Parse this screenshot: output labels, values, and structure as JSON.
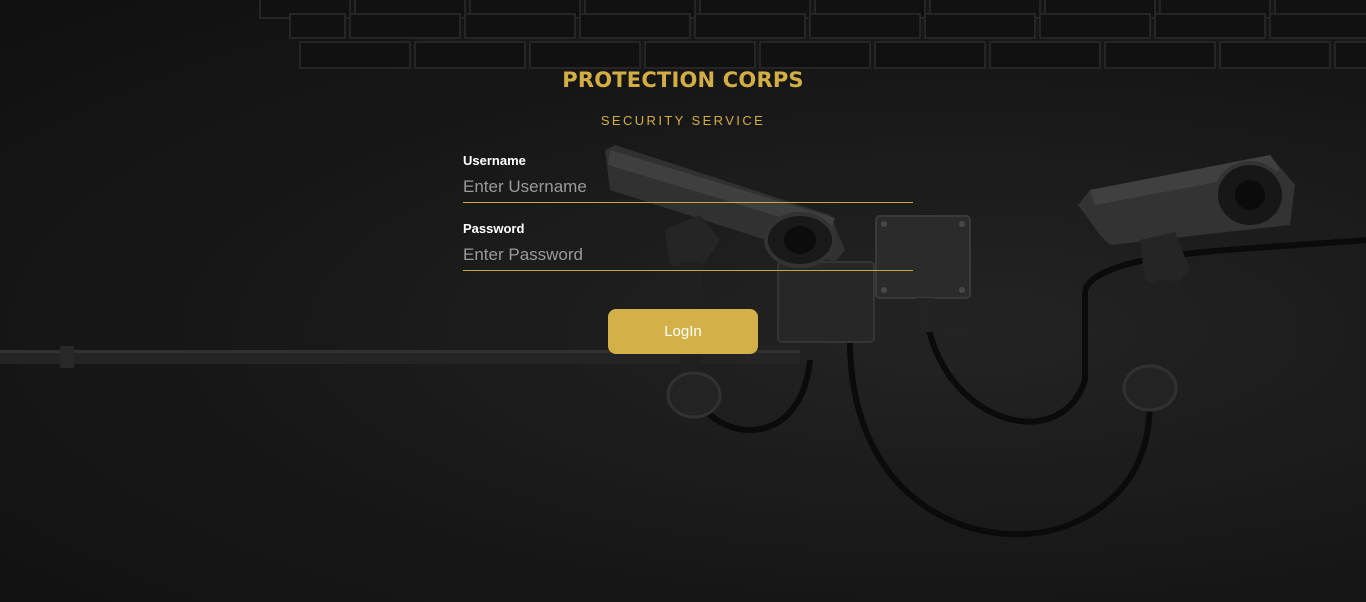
{
  "brand": {
    "title": "PROTECTION CORPS",
    "subtitle": "SECURITY SERVICE"
  },
  "form": {
    "username": {
      "label": "Username",
      "placeholder": "Enter Username",
      "value": ""
    },
    "password": {
      "label": "Password",
      "placeholder": "Enter Password",
      "value": ""
    },
    "login_label": "LogIn"
  },
  "colors": {
    "accent": "#d4b148",
    "background": "#1b1b1b",
    "label": "#ffffff"
  },
  "background_image": {
    "subject": "security-cameras-on-brick-wall"
  }
}
